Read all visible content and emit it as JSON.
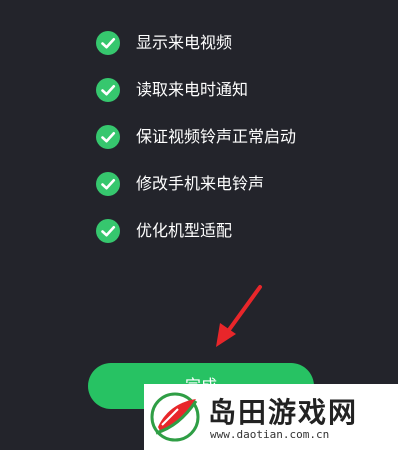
{
  "permissions": [
    {
      "label": "显示来电视频"
    },
    {
      "label": "读取来电时通知"
    },
    {
      "label": "保证视频铃声正常启动"
    },
    {
      "label": "修改手机来电铃声"
    },
    {
      "label": "优化机型适配"
    }
  ],
  "icons": {
    "check": "check-circle-icon",
    "arrow": "red-arrow-annotation"
  },
  "done_button": {
    "label": "完成"
  },
  "watermark": {
    "title": "岛田游戏网",
    "url": "www.daotian.com.cn"
  },
  "colors": {
    "background": "#23242b",
    "check": "#36c76e",
    "button": "#27c263",
    "arrow": "#e8262a"
  }
}
